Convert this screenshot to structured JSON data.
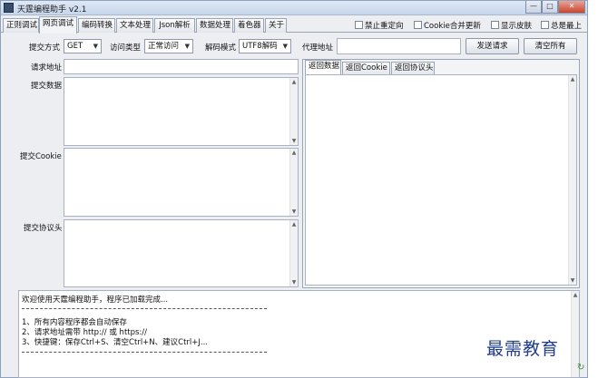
{
  "window": {
    "title": "天霆编程助手 v2.1",
    "controls": {
      "minimize": "—",
      "maximize": "□",
      "close": "✕"
    }
  },
  "tabs": [
    {
      "label": "正则调试",
      "active": false
    },
    {
      "label": "网页调试",
      "active": true
    },
    {
      "label": "编码转换",
      "active": false
    },
    {
      "label": "文本处理",
      "active": false
    },
    {
      "label": "Json解析",
      "active": false
    },
    {
      "label": "数据处理",
      "active": false
    },
    {
      "label": "着色器",
      "active": false
    },
    {
      "label": "关于",
      "active": false
    }
  ],
  "options": [
    {
      "label": "禁止重定向",
      "checked": false
    },
    {
      "label": "Cookie合并更新",
      "checked": false
    },
    {
      "label": "显示皮肤",
      "checked": false
    },
    {
      "label": "总是最上",
      "checked": false
    }
  ],
  "request": {
    "method_label": "提交方式",
    "method_value": "GET",
    "access_label": "访问类型",
    "access_value": "正常访问",
    "decode_label": "解码模式",
    "decode_value": "UTF8解码",
    "proxy_label": "代理地址",
    "proxy_value": "",
    "send_button": "发送请求",
    "clear_button": "清空所有",
    "url_label": "请求地址",
    "url_value": "",
    "data_label": "提交数据",
    "cookie_label": "提交Cookie",
    "headers_label": "提交协议头"
  },
  "response": {
    "tabs": [
      {
        "label": "返回数据",
        "active": true
      },
      {
        "label": "返回Cookie",
        "active": false
      },
      {
        "label": "返回协议头",
        "active": false
      }
    ]
  },
  "log": {
    "lines": [
      "欢迎使用天霆编程助手，程序已加载完成...",
      "1、所有内容程序都会自动保存",
      "2、请求地址需带 http:// 或 https://",
      "3、快捷键：保存Ctrl+S、清空Ctrl+N、建议Ctrl+J..."
    ]
  },
  "watermark": "最需教育",
  "colors": {
    "window_bg": "#eceef2",
    "border": "#9aa6b8",
    "watermark": "#1f3d8a"
  }
}
